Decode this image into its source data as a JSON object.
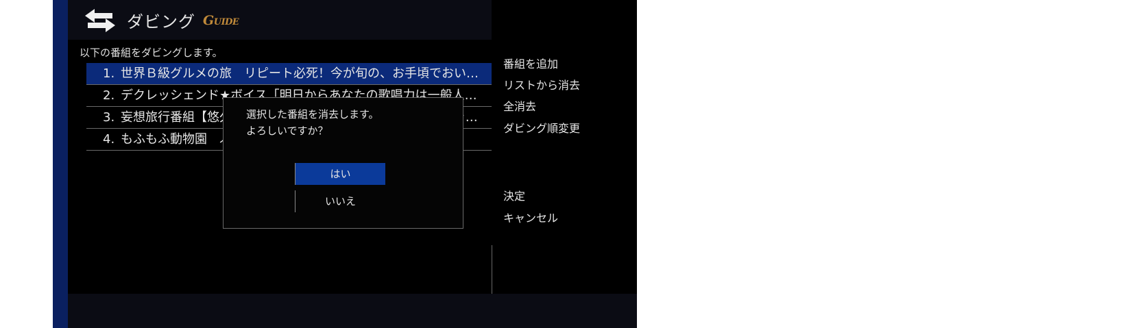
{
  "header": {
    "title": "ダビング",
    "logo_prefix": "G",
    "logo_text": "UIDE",
    "icon": "swap-arrows-icon"
  },
  "instruction": "以下の番組をダビングします。",
  "programs": [
    {
      "num": "1.",
      "title": "世界Ｂ級グルメの旅　リピート必死！今が旬の、お手頃でおいし…"
    },
    {
      "num": "2.",
      "title": "デクレッシェンド★ボイス「明日からあなたの歌唱力は一般人の…"
    },
    {
      "num": "3.",
      "title": "妄想旅行番組【悠久の時を超えて過去への旅路】～タイムトラベルスポット…"
    },
    {
      "num": "4.",
      "title": "もふもふ動物園　ふわふわの動物たちとのふれあいタイム"
    }
  ],
  "menu": {
    "add_program": "番組を追加",
    "remove_from_list": "リストから消去",
    "remove_all": "全消去",
    "change_order": "ダビング順変更",
    "confirm": "決定",
    "cancel": "キャンセル"
  },
  "dialog": {
    "line1": "選択した番組を消去します。",
    "line2": "よろしいですか？",
    "yes": "はい",
    "no": "いいえ"
  },
  "colors": {
    "selection": "#0b2a7a",
    "focused_button": "#0b3a9a",
    "logo": "#c08a3a"
  }
}
